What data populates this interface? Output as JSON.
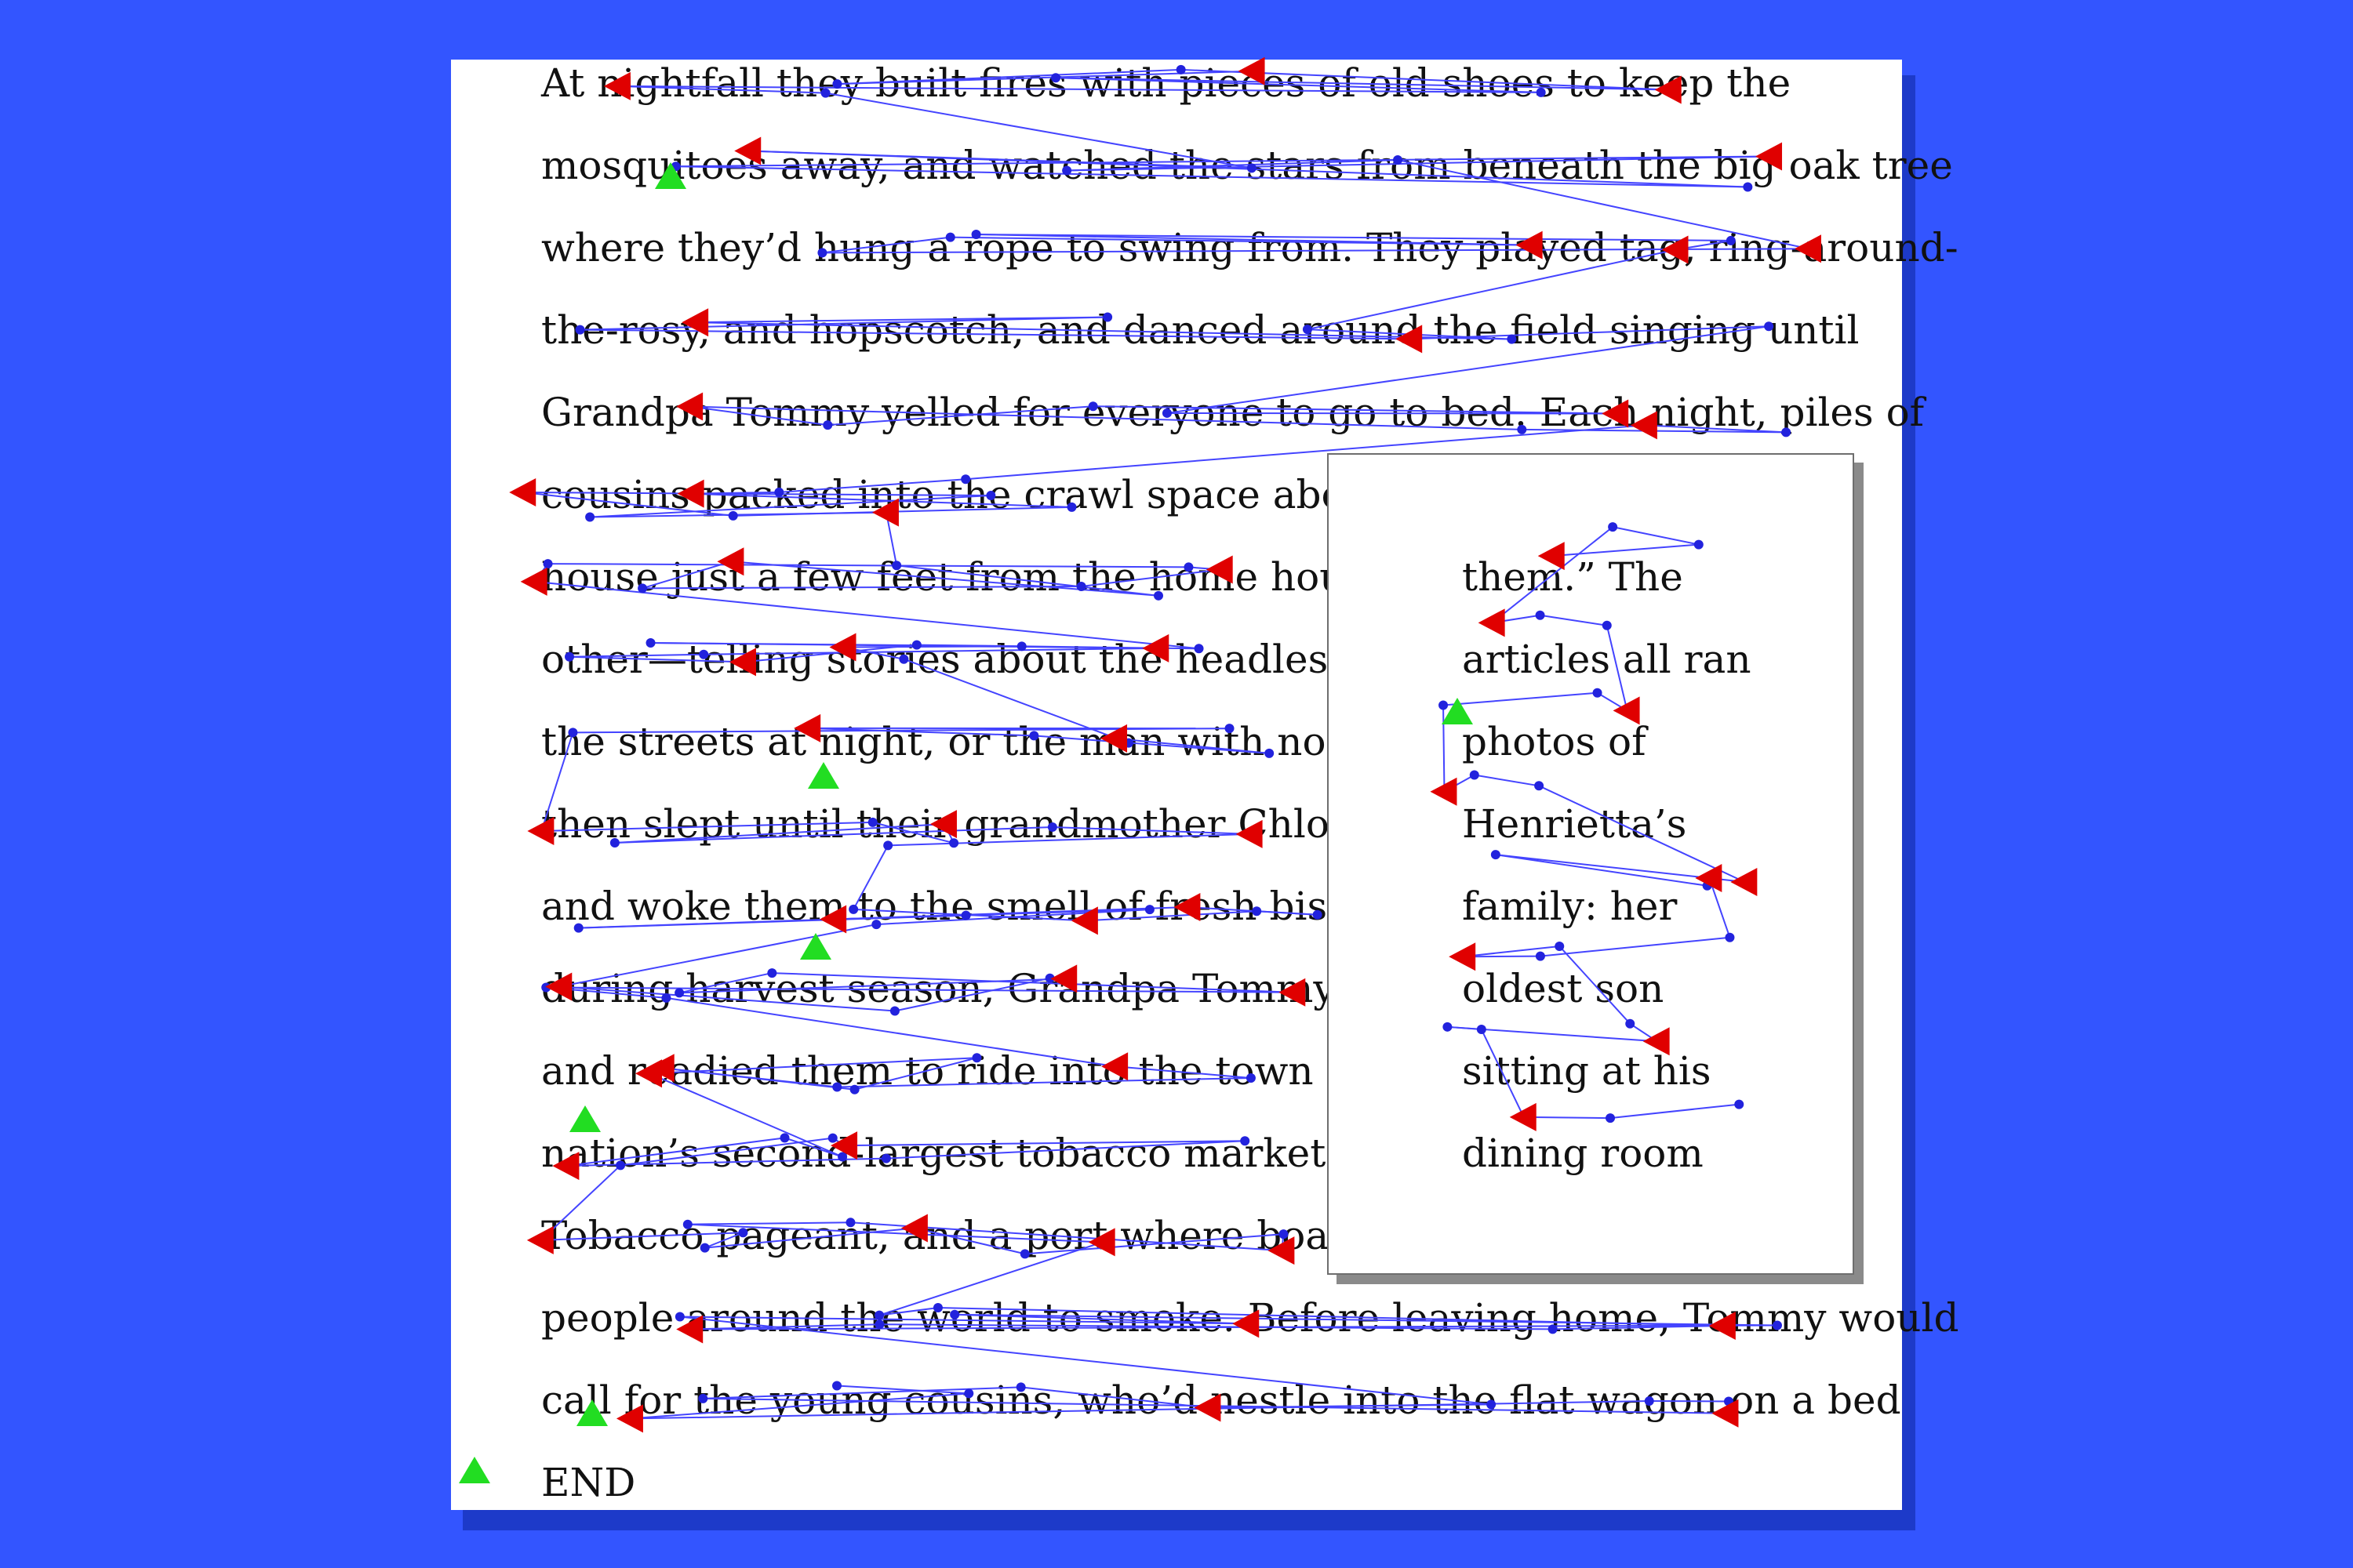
{
  "main_text": {
    "lines": [
      "At nightfall they built fires with pieces of old shoes to keep the",
      "mosquitoes away, and watched the stars from beneath the big oak tree",
      "where they’d hung a rope to swing from. They played tag, ring-around-",
      "the-rosy, and hopscotch, and danced around the field singing until",
      "Grandpa Tommy yelled for everyone to go to bed. Each night, piles of",
      "cousins packed into the crawl space above",
      "house just a few feet from the home house",
      "other—telling stories about the headless to",
      "the streets at night, or the man with no eye",
      "then slept until their grandmother Chloe f",
      "and woke them to the smell of fresh biscui",
      "during harvest season, Grandpa Tommy h",
      "and readied them to ride into the town of S",
      "nation’s second-largest tobacco market, w",
      "Tobacco pageant, and a port where boats c",
      "people around the world to smoke. Before leaving home, Tommy would",
      "call for the young cousins, who’d nestle into the flat wagon on a bed",
      "END"
    ]
  },
  "popup_text": {
    "lines": [
      "them.” The",
      "articles all ran",
      "photos of",
      "Henrietta’s",
      "family: her",
      "oldest son",
      "sitting at his",
      "dining room"
    ]
  },
  "gaze_overlay": {
    "fixation_color": "#2222dd",
    "path_color": "#4444ff",
    "regression_marker_color": "#e00000",
    "start_marker_color": "#22dd22"
  }
}
